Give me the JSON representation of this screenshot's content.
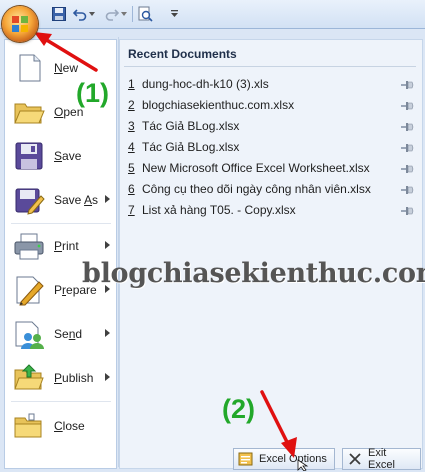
{
  "toolbar": {
    "icons": [
      "office-button-icon",
      "save-icon",
      "undo-icon",
      "redo-icon",
      "print-preview-icon",
      "customize-icon"
    ]
  },
  "menu": {
    "items": [
      {
        "label": "New",
        "icon": "new-document-icon",
        "submenu": false
      },
      {
        "label": "Open",
        "icon": "open-folder-icon",
        "submenu": false
      },
      {
        "label": "Save",
        "icon": "save-disk-icon",
        "submenu": false
      },
      {
        "label": "Save As",
        "icon": "save-as-icon",
        "submenu": true
      },
      {
        "label": "Print",
        "icon": "printer-icon",
        "submenu": true
      },
      {
        "label": "Prepare",
        "icon": "prepare-pen-icon",
        "submenu": true
      },
      {
        "label": "Send",
        "icon": "send-people-icon",
        "submenu": true
      },
      {
        "label": "Publish",
        "icon": "publish-folder-icon",
        "submenu": true
      },
      {
        "label": "Close",
        "icon": "close-folder-icon",
        "submenu": false
      }
    ]
  },
  "recent": {
    "title": "Recent Documents",
    "files": [
      {
        "num": "1",
        "name": "dung-hoc-dh-k10 (3).xls"
      },
      {
        "num": "2",
        "name": "blogchiasekienthuc.com.xlsx"
      },
      {
        "num": "3",
        "name": "Tác Giả BLog.xlsx"
      },
      {
        "num": "4",
        "name": "Tác Giả BLog.xlsx"
      },
      {
        "num": "5",
        "name": "New Microsoft Office Excel Worksheet.xlsx"
      },
      {
        "num": "6",
        "name": "Công cụ theo dõi ngày công nhân viên.xlsx"
      },
      {
        "num": "7",
        "name": "List xả hàng T05. - Copy.xlsx"
      }
    ]
  },
  "buttons": {
    "options_label": "Excel Options",
    "exit_label": "Exit Excel"
  },
  "annotations": {
    "step1": "(1)",
    "step2": "(2)",
    "watermark": "blogchiasekienthuc.com"
  },
  "colors": {
    "accent": "#dbe6f5",
    "step_green": "#22a82a",
    "arrow_red": "#e01010"
  }
}
